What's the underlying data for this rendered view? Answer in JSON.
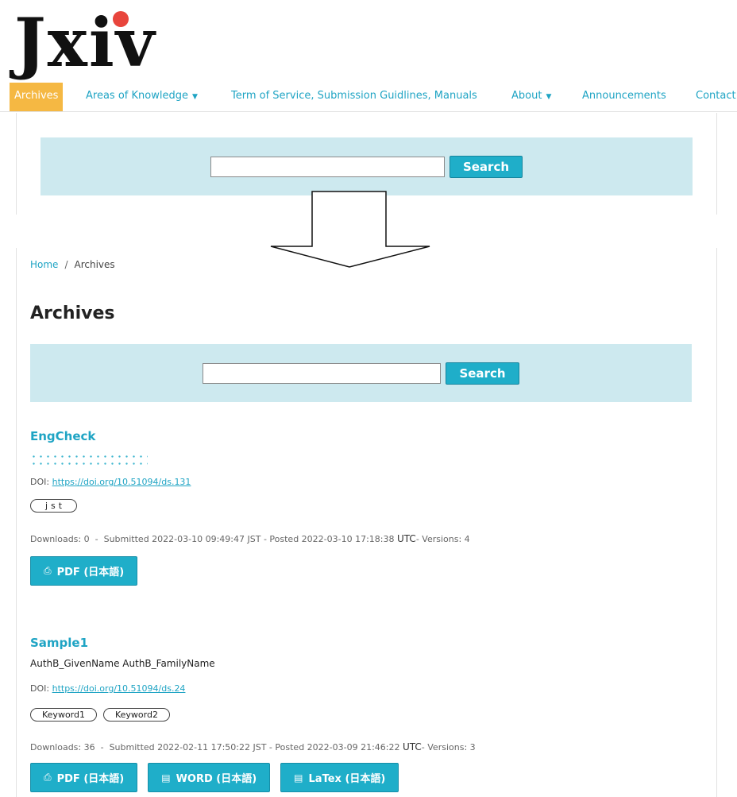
{
  "logo": {
    "text": "Jxiv"
  },
  "nav": {
    "items": [
      {
        "label": "Archives"
      },
      {
        "label": "Areas of Knowledge"
      },
      {
        "label": "Term of Service, Submission Guidlines, Manuals"
      },
      {
        "label": "About"
      },
      {
        "label": "Announcements"
      },
      {
        "label": "Contact"
      }
    ]
  },
  "top_search": {
    "value": "",
    "button": "Search"
  },
  "breadcrumb": {
    "home": "Home",
    "separator": "/",
    "current": "Archives"
  },
  "page_title": "Archives",
  "search": {
    "value": "",
    "button": "Search"
  },
  "items": [
    {
      "title": "EngCheck",
      "authors": "",
      "doi_label": "DOI:",
      "doi_url": "https://doi.org/10.51094/ds.131",
      "keywords": [
        "jst"
      ],
      "stats": {
        "downloads": "Downloads: 0",
        "submitted": "Submitted 2022-03-10 09:49:47 JST",
        "posted": "Posted 2022-03-10 17:18:38",
        "utc": "UTC",
        "versions": "Versions: 4"
      },
      "buttons": [
        {
          "icon": "pdf-icon",
          "label": "PDF (日本語)"
        }
      ]
    },
    {
      "title": "Sample1",
      "authors": "AuthB_GivenName AuthB_FamilyName",
      "doi_label": "DOI:",
      "doi_url": "https://doi.org/10.51094/ds.24",
      "keywords": [
        "Keyword1",
        "Keyword2"
      ],
      "stats": {
        "downloads": "Downloads: 36",
        "submitted": "Submitted 2022-02-11 17:50:22 JST",
        "posted": "Posted 2022-03-09 21:46:22",
        "utc": "UTC",
        "versions": "Versions: 3"
      },
      "buttons": [
        {
          "icon": "pdf-icon",
          "label": "PDF (日本語)"
        },
        {
          "icon": "document-icon",
          "label": "WORD (日本語)"
        },
        {
          "icon": "document-icon",
          "label": "LaTex (日本語)"
        }
      ]
    }
  ],
  "colors": {
    "accent": "#1faec9",
    "nav_active": "#f5b843",
    "panel": "#cde9ef",
    "logo_dot": "#e8453c"
  }
}
